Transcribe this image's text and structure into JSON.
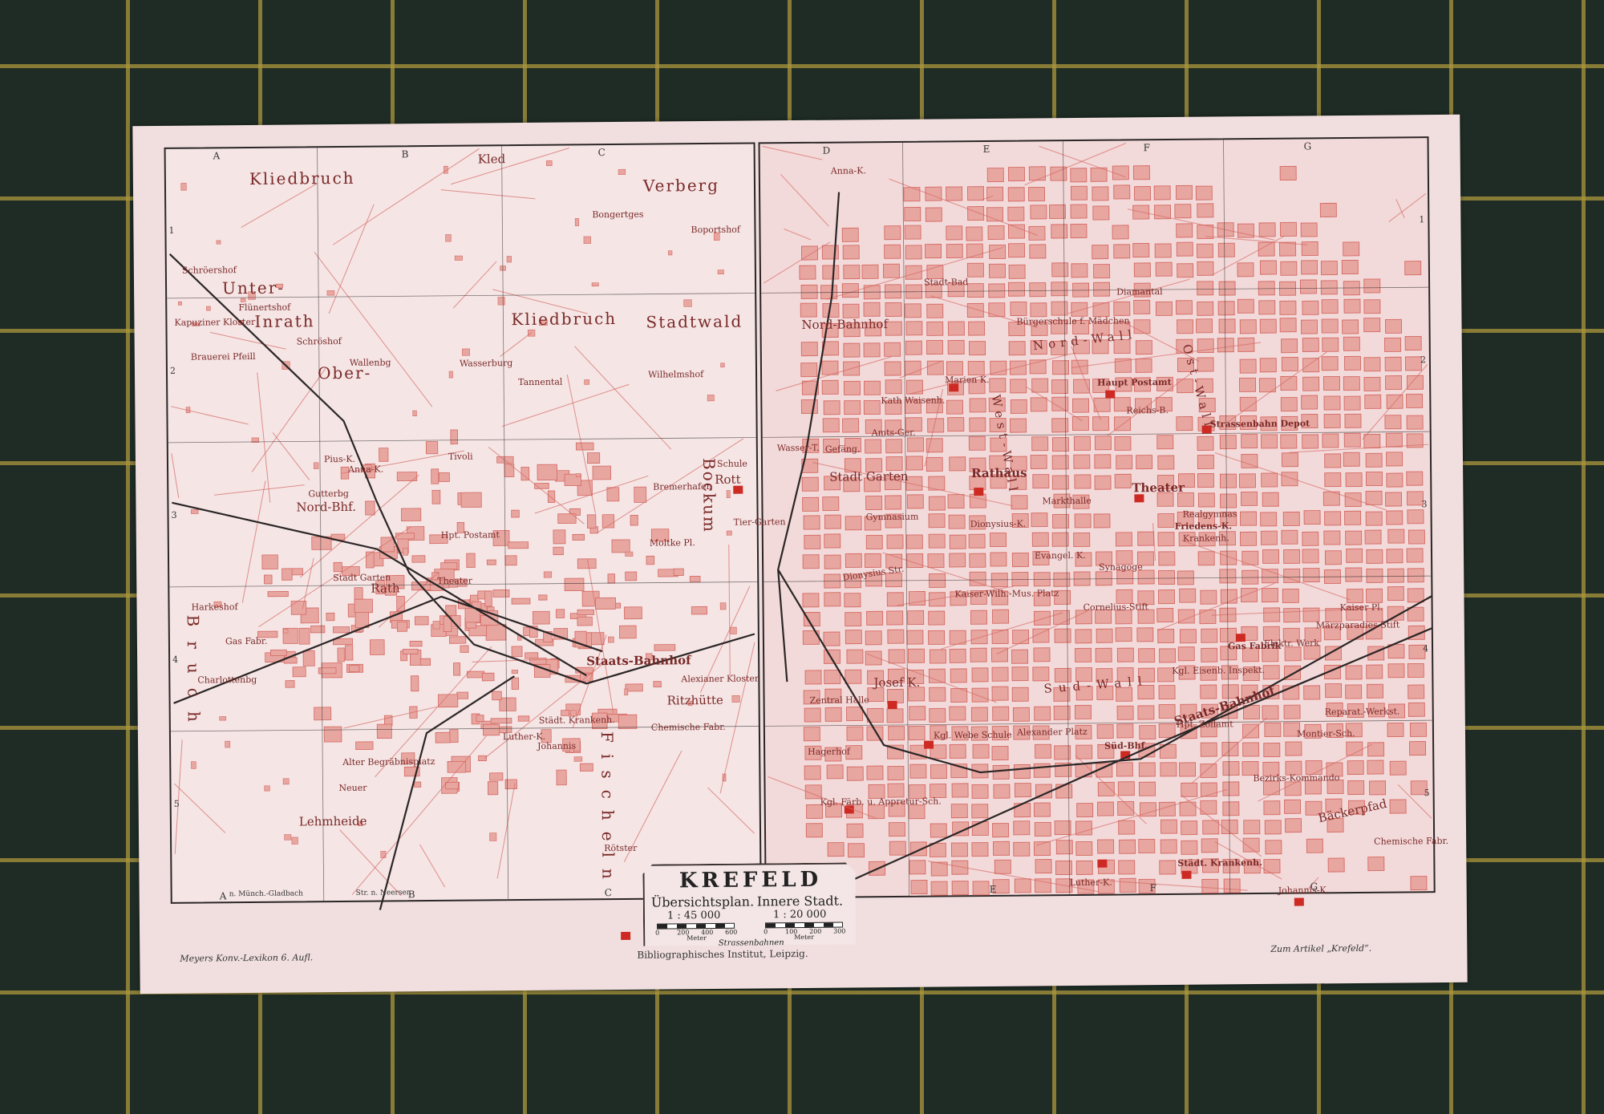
{
  "title": "KREFELD",
  "left_map": {
    "subtitle": "Übersichtsplan.",
    "scale": "1 : 45 000",
    "scale_ticks": [
      "0",
      "200",
      "400",
      "600"
    ],
    "scale_unit": "Meter",
    "labels": [
      "Kliedbruch",
      "Kled",
      "Verberg",
      "Unter-",
      "Inrath",
      "Ober-",
      "Kliedbruch",
      "Stadtwald",
      "Bongertges",
      "Boportshof",
      "Schröershof",
      "Flünertshof",
      "Schröshof",
      "Wallenbg",
      "Wasserburg",
      "Tannental",
      "Wilhelmshof",
      "Nord-Bhf.",
      "Stadt Garten",
      "Rath",
      "Theater",
      "Hpt. Postamt",
      "Staats-Bahnhof",
      "Ritzhütte",
      "Bockum",
      "Alter Begräbnisplatz",
      "Neuer",
      "Lehmheide",
      "Charlottenbg",
      "Harkeshof",
      "Gas Fabr.",
      "Bruch",
      "Fischeln",
      "Rötster",
      "Johannis",
      "Luther-K.",
      "Alexianer Kloster",
      "Tivoli",
      "Kapuziner Kloster",
      "Gutterbg",
      "Anna-K.",
      "Pius-K.",
      "Bremerhafen",
      "Schule",
      "Rott",
      "Tier-Garten",
      "Moltke Pl.",
      "Städt. Krankenh.",
      "Chemische Fabr.",
      "Brauerei Pfeill",
      "Strassenbahnen"
    ],
    "grid_letters": [
      "A",
      "B",
      "C"
    ],
    "grid_numbers": [
      "1",
      "2",
      "3",
      "4",
      "5"
    ],
    "bottom_notes": [
      "n. Münch.-Gladbach",
      "Str. n. Neersen"
    ]
  },
  "right_map": {
    "subtitle": "Innere Stadt.",
    "scale": "1 : 20 000",
    "scale_ticks": [
      "0",
      "100",
      "200",
      "300"
    ],
    "scale_unit": "Meter",
    "labels": [
      "Anna-K.",
      "Nord-Bahnhof",
      "Stadt Garten",
      "Rathaus",
      "Theater",
      "Haupt Postamt",
      "Marien K.",
      "Gymnasium",
      "Synagoge",
      "Gas Fabrik",
      "Staats-Bahnhof",
      "Süd-Bhf.",
      "Josef K.",
      "Hagerhof",
      "Zentral Halle",
      "Bezirks-Kommando",
      "Montier-Sch.",
      "Bäckerpfad",
      "Städt. Krankenh.",
      "Johannis-K.",
      "Luther-K.",
      "Chemische Fabr.",
      "Kaiser-Wilh.-Mus. Platz",
      "Dionysius-K.",
      "Markthalle",
      "Friedens-K.",
      "Kaiser Pl.",
      "Elektr. Werk",
      "Strassenbahn Depot",
      "Reichs-B.",
      "Bürgerschule f. Mädchen",
      "Stadt-Bad",
      "Diamantal",
      "Kath Waisenh.",
      "Amts-Ger.",
      "Gefäng.",
      "Realgymnas",
      "Krankenh.",
      "Kgl. Eisenb. Inspekt.",
      "Hpt. Zollamt",
      "Kgl. Webe Schule",
      "Alexander Platz",
      "Kgl. Färb. u. Appretur-Sch.",
      "Reparat.-Werkst.",
      "Märzparadies Stift",
      "Cornelius-Stift",
      "Evangel. K.",
      "Wasser-T.",
      "Dionysius Str.",
      "Sud-Wall",
      "Ost-Wall",
      "West-Wall",
      "Nord-Wall"
    ],
    "grid_letters": [
      "D",
      "E",
      "F",
      "G"
    ],
    "grid_numbers": [
      "1",
      "2",
      "3",
      "4",
      "5"
    ]
  },
  "footer": {
    "left": "Meyers Konv.-Lexikon 6. Aufl.",
    "center": "Bibliographisches Institut, Leipzig.",
    "right": "Zum Artikel „Krefeld“."
  },
  "colors": {
    "paper": "#f1dfdf",
    "block": "#e8a6a0",
    "road": "#d46a64",
    "building": "#cc2a23",
    "frame": "#2b2626",
    "mat": "#1f2c25",
    "grid": "#aa963c"
  }
}
